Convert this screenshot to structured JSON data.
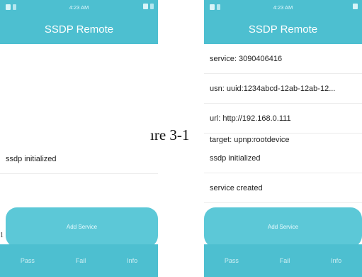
{
  "screens": [
    {
      "status_time": "4:23 AM",
      "title": "SSDP Remote",
      "items": [
        "ssdp initialized"
      ],
      "add_service_label": "Add Service",
      "bottom": [
        "Pass",
        "Fail",
        "Info"
      ]
    },
    {
      "status_time": "4:23 AM",
      "title": "SSDP Remote",
      "items": [
        "service: 3090406416",
        "usn: uuid:1234abcd-12ab-12ab-12...",
        "url: http://192.168.0.111",
        "target: upnp:rootdevice",
        "ssdp initialized",
        "service created"
      ],
      "add_service_label": "Add Service",
      "bottom": [
        "Pass",
        "Fail",
        "Info"
      ]
    }
  ],
  "figure_caption": "ıre 3-1",
  "left_margin_mark": "1",
  "colors": {
    "accent": "#4dbfd0",
    "button": "#5cc8d7"
  },
  "icons": [
    "status-left-icons",
    "status-right-icons"
  ]
}
